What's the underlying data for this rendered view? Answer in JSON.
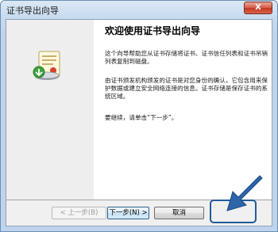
{
  "window": {
    "title": "证书导出向导",
    "close_glyph": "X"
  },
  "main": {
    "heading": "欢迎使用证书导出向导",
    "paragraphs": [
      "这个向导帮助您从证书存储将证书、证书信任列表和证书吊销列表复制到磁盘。",
      "由证书颁发机构颁发的证书是对您身份的确认，它包含用来保护数据或建立安全网络连接的信息。证书存储是保存证书的系统区域。",
      "要继续，请单击“下一步”。"
    ]
  },
  "buttons": {
    "back": "< 上一步(B)",
    "next": "下一步(N) >",
    "cancel": "取消"
  },
  "colors": {
    "annotation_arrow": "#2e64a8",
    "highlight_box": "#1f5c9a"
  }
}
